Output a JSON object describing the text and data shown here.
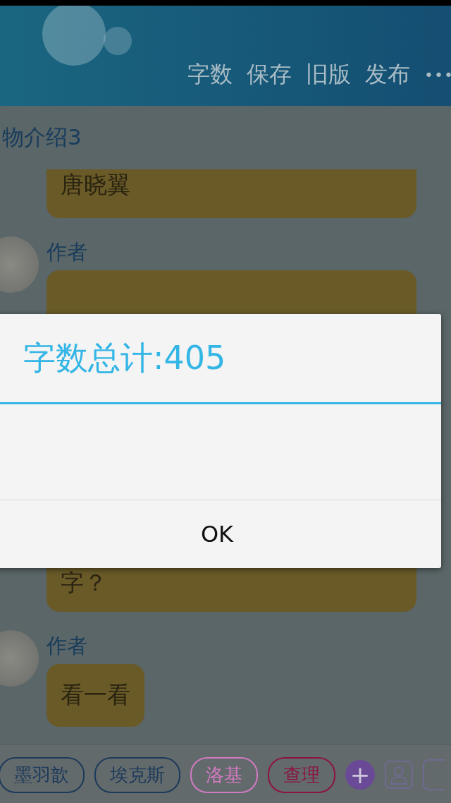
{
  "header": {
    "actions": [
      "字数",
      "保存",
      "旧版",
      "发布"
    ],
    "more": "•••"
  },
  "chapter_title": "物介绍3",
  "messages": [
    {
      "kind": "continued",
      "text": "唐晓翼"
    },
    {
      "kind": "authored",
      "author": "作者",
      "text": "字？"
    },
    {
      "kind": "authored",
      "author": "作者",
      "text": "看一看"
    }
  ],
  "characters": [
    {
      "label": "墨羽歆",
      "color": "#1c3a5a"
    },
    {
      "label": "埃克斯",
      "color": "#1c3a5a"
    },
    {
      "label": "洛基",
      "color": "#d27ac2"
    },
    {
      "label": "查理",
      "color": "#8c1440"
    }
  ],
  "add_button": "+",
  "dialog": {
    "title": "字数总计:405",
    "button": "OK"
  }
}
